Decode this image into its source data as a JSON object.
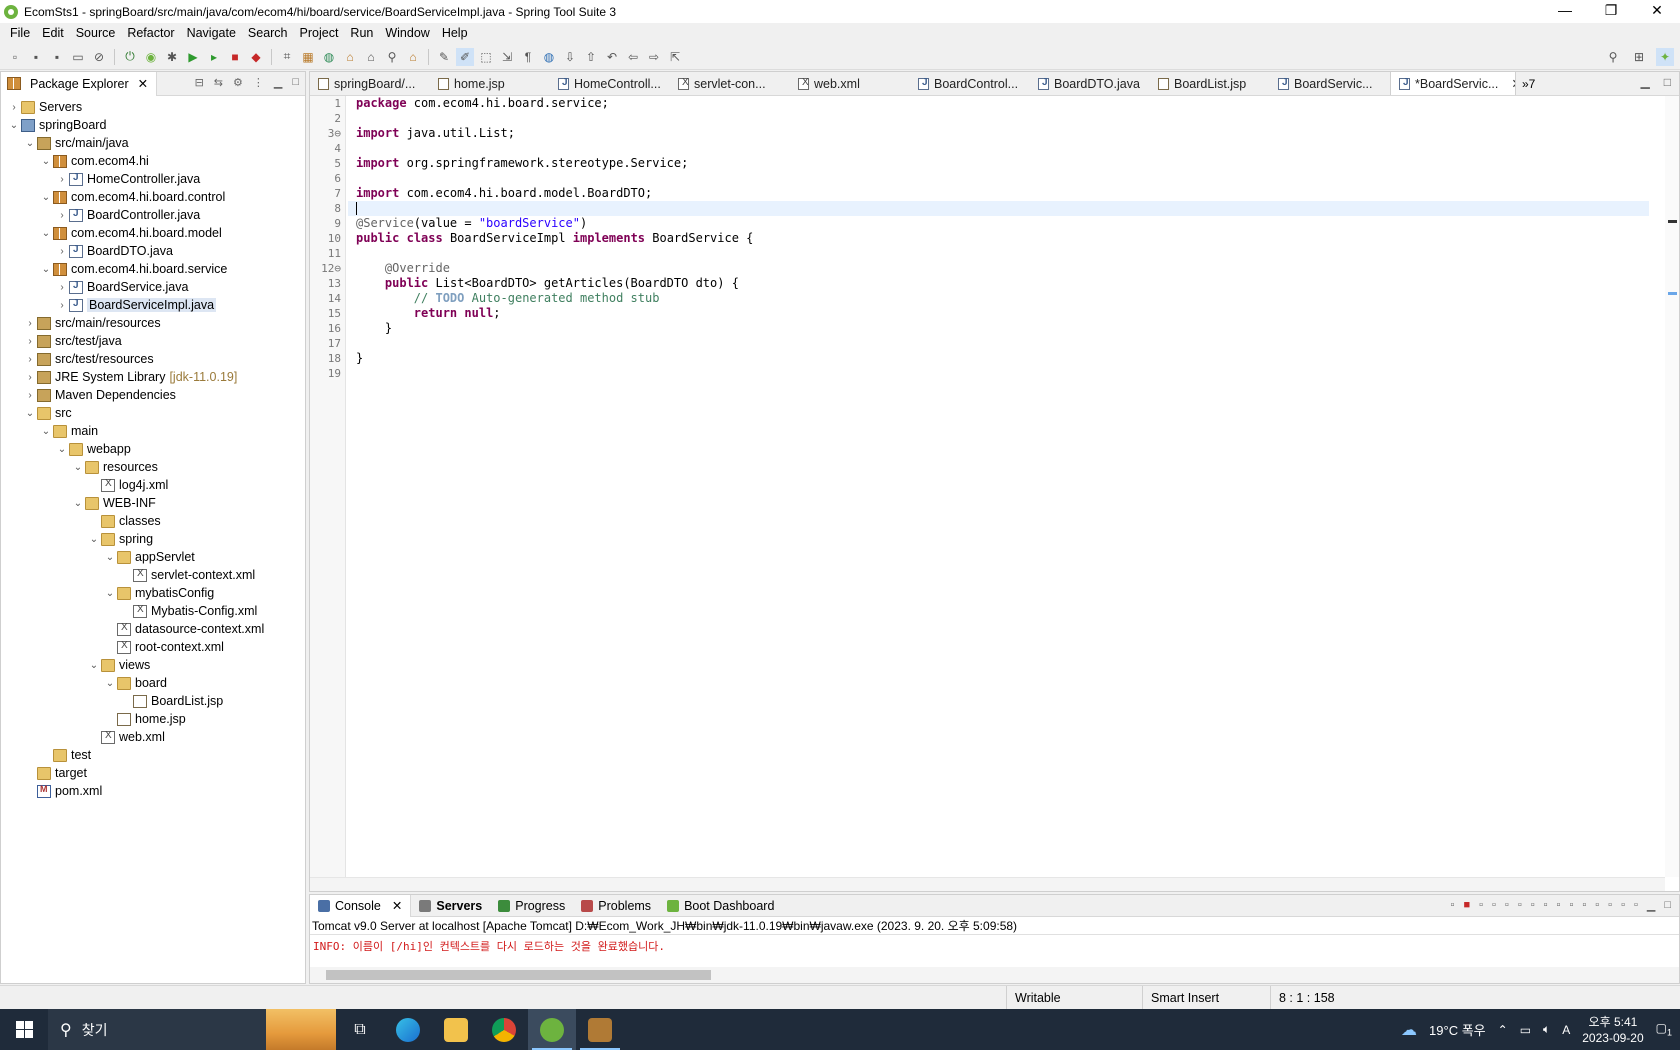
{
  "window": {
    "title": "EcomSts1 - springBoard/src/main/java/com/ecom4/hi/board/service/BoardServiceImpl.java - Spring Tool Suite 3",
    "minimize": "—",
    "restore": "❐",
    "close": "✕"
  },
  "menu": [
    "File",
    "Edit",
    "Source",
    "Refactor",
    "Navigate",
    "Search",
    "Project",
    "Run",
    "Window",
    "Help"
  ],
  "package_explorer": {
    "tab_label": "Package Explorer",
    "tree": [
      {
        "label": "Servers",
        "indent": 0,
        "twisty": "›",
        "icon": "folder"
      },
      {
        "label": "springBoard",
        "indent": 0,
        "twisty": "⌄",
        "icon": "proj"
      },
      {
        "label": "src/main/java",
        "indent": 1,
        "twisty": "⌄",
        "icon": "lib"
      },
      {
        "label": "com.ecom4.hi",
        "indent": 2,
        "twisty": "⌄",
        "icon": "pkg"
      },
      {
        "label": "HomeController.java",
        "indent": 3,
        "twisty": "›",
        "icon": "java"
      },
      {
        "label": "com.ecom4.hi.board.control",
        "indent": 2,
        "twisty": "⌄",
        "icon": "pkg"
      },
      {
        "label": "BoardController.java",
        "indent": 3,
        "twisty": "›",
        "icon": "java"
      },
      {
        "label": "com.ecom4.hi.board.model",
        "indent": 2,
        "twisty": "⌄",
        "icon": "pkg"
      },
      {
        "label": "BoardDTO.java",
        "indent": 3,
        "twisty": "›",
        "icon": "java"
      },
      {
        "label": "com.ecom4.hi.board.service",
        "indent": 2,
        "twisty": "⌄",
        "icon": "pkg"
      },
      {
        "label": "BoardService.java",
        "indent": 3,
        "twisty": "›",
        "icon": "java"
      },
      {
        "label": "BoardServiceImpl.java",
        "indent": 3,
        "twisty": "›",
        "icon": "java",
        "selected": true
      },
      {
        "label": "src/main/resources",
        "indent": 1,
        "twisty": "›",
        "icon": "lib"
      },
      {
        "label": "src/test/java",
        "indent": 1,
        "twisty": "›",
        "icon": "lib"
      },
      {
        "label": "src/test/resources",
        "indent": 1,
        "twisty": "›",
        "icon": "lib"
      },
      {
        "label": "JRE System Library",
        "indent": 1,
        "twisty": "›",
        "icon": "lib",
        "suffix": "[jdk-11.0.19]"
      },
      {
        "label": "Maven Dependencies",
        "indent": 1,
        "twisty": "›",
        "icon": "lib"
      },
      {
        "label": "src",
        "indent": 1,
        "twisty": "⌄",
        "icon": "folder"
      },
      {
        "label": "main",
        "indent": 2,
        "twisty": "⌄",
        "icon": "folder"
      },
      {
        "label": "webapp",
        "indent": 3,
        "twisty": "⌄",
        "icon": "folder"
      },
      {
        "label": "resources",
        "indent": 4,
        "twisty": "⌄",
        "icon": "folder"
      },
      {
        "label": "log4j.xml",
        "indent": 5,
        "twisty": "",
        "icon": "xml"
      },
      {
        "label": "WEB-INF",
        "indent": 4,
        "twisty": "⌄",
        "icon": "folder"
      },
      {
        "label": "classes",
        "indent": 5,
        "twisty": "",
        "icon": "folder"
      },
      {
        "label": "spring",
        "indent": 5,
        "twisty": "⌄",
        "icon": "folder"
      },
      {
        "label": "appServlet",
        "indent": 6,
        "twisty": "⌄",
        "icon": "folder"
      },
      {
        "label": "servlet-context.xml",
        "indent": 7,
        "twisty": "",
        "icon": "xml"
      },
      {
        "label": "mybatisConfig",
        "indent": 6,
        "twisty": "⌄",
        "icon": "folder"
      },
      {
        "label": "Mybatis-Config.xml",
        "indent": 7,
        "twisty": "",
        "icon": "xml"
      },
      {
        "label": "datasource-context.xml",
        "indent": 6,
        "twisty": "",
        "icon": "xml"
      },
      {
        "label": "root-context.xml",
        "indent": 6,
        "twisty": "",
        "icon": "xml"
      },
      {
        "label": "views",
        "indent": 5,
        "twisty": "⌄",
        "icon": "folder"
      },
      {
        "label": "board",
        "indent": 6,
        "twisty": "⌄",
        "icon": "folder"
      },
      {
        "label": "BoardList.jsp",
        "indent": 7,
        "twisty": "",
        "icon": "jsp"
      },
      {
        "label": "home.jsp",
        "indent": 6,
        "twisty": "",
        "icon": "jsp"
      },
      {
        "label": "web.xml",
        "indent": 5,
        "twisty": "",
        "icon": "xml"
      },
      {
        "label": "test",
        "indent": 2,
        "twisty": "",
        "icon": "folder"
      },
      {
        "label": "target",
        "indent": 1,
        "twisty": "",
        "icon": "folder"
      },
      {
        "label": "pom.xml",
        "indent": 1,
        "twisty": "",
        "icon": "mvn"
      }
    ]
  },
  "editor": {
    "tabs": [
      {
        "label": "springBoard/...",
        "icon": "jsp"
      },
      {
        "label": "home.jsp",
        "icon": "jsp"
      },
      {
        "label": "HomeControll...",
        "icon": "java"
      },
      {
        "label": "servlet-con...",
        "icon": "xml"
      },
      {
        "label": "web.xml",
        "icon": "xml"
      },
      {
        "label": "BoardControl...",
        "icon": "java"
      },
      {
        "label": "BoardDTO.java",
        "icon": "java"
      },
      {
        "label": "BoardList.jsp",
        "icon": "jsp"
      },
      {
        "label": "BoardServic...",
        "icon": "java"
      },
      {
        "label": "*BoardServic...",
        "icon": "java",
        "active": true
      }
    ],
    "overflow_label": "»7",
    "lines": [
      {
        "n": "1",
        "tokens": [
          [
            "kw",
            "package"
          ],
          [
            "",
            " com.ecom4.hi.board.service;"
          ]
        ]
      },
      {
        "n": "2",
        "tokens": []
      },
      {
        "n": "3⊖",
        "tokens": [
          [
            "kw",
            "import"
          ],
          [
            "",
            " java.util.List;"
          ]
        ]
      },
      {
        "n": "4",
        "tokens": []
      },
      {
        "n": "5",
        "tokens": [
          [
            "kw",
            "import"
          ],
          [
            "",
            " org.springframework.stereotype.Service;"
          ]
        ]
      },
      {
        "n": "6",
        "tokens": []
      },
      {
        "n": "7",
        "tokens": [
          [
            "kw",
            "import"
          ],
          [
            "",
            " com.ecom4.hi.board.model.BoardDTO;"
          ]
        ]
      },
      {
        "n": "8",
        "tokens": [],
        "current": true
      },
      {
        "n": "9",
        "tokens": [
          [
            "ann",
            "@Service"
          ],
          [
            "",
            "(value = "
          ],
          [
            "str",
            "\"boardService\""
          ],
          [
            "",
            ")"
          ]
        ]
      },
      {
        "n": "10",
        "tokens": [
          [
            "kw",
            "public"
          ],
          [
            "",
            " "
          ],
          [
            "kw",
            "class"
          ],
          [
            "",
            " BoardServiceImpl "
          ],
          [
            "kw",
            "implements"
          ],
          [
            "",
            " BoardService {"
          ]
        ]
      },
      {
        "n": "11",
        "tokens": []
      },
      {
        "n": "12⊖",
        "tokens": [
          [
            "",
            "    "
          ],
          [
            "ann",
            "@Override"
          ]
        ]
      },
      {
        "n": "13",
        "tokens": [
          [
            "",
            "    "
          ],
          [
            "kw",
            "public"
          ],
          [
            "",
            " List<BoardDTO> getArticles(BoardDTO dto) {"
          ]
        ]
      },
      {
        "n": "14",
        "tokens": [
          [
            "",
            "        "
          ],
          [
            "cmt",
            "// "
          ],
          [
            "todo",
            "TODO"
          ],
          [
            "cmt",
            " Auto-generated method stub"
          ]
        ]
      },
      {
        "n": "15",
        "tokens": [
          [
            "",
            "        "
          ],
          [
            "kw",
            "return"
          ],
          [
            "",
            " "
          ],
          [
            "kw",
            "null"
          ],
          [
            "",
            ";"
          ]
        ]
      },
      {
        "n": "16",
        "tokens": [
          [
            "",
            "    }"
          ]
        ]
      },
      {
        "n": "17",
        "tokens": []
      },
      {
        "n": "18",
        "tokens": [
          [
            "",
            "}"
          ]
        ]
      },
      {
        "n": "19",
        "tokens": []
      }
    ]
  },
  "console": {
    "tabs": [
      {
        "label": "Console",
        "active": true,
        "color": "#4a6fa5"
      },
      {
        "label": "Servers",
        "bold": true,
        "color": "#7a7a7a"
      },
      {
        "label": "Progress",
        "color": "#3c8c3c"
      },
      {
        "label": "Problems",
        "color": "#b84a4a"
      },
      {
        "label": "Boot Dashboard",
        "color": "#6db33f"
      }
    ],
    "server_line": "Tomcat v9.0 Server at localhost [Apache Tomcat] D:₩Ecom_Work_JH₩bin₩jdk-11.0.19₩bin₩javaw.exe  (2023. 9. 20. 오후 5:09:58)",
    "output": "INFO: 이름이 [/hi]인 컨텍스트를 다시 로드하는 것을 완료했습니다."
  },
  "status": {
    "writable": "Writable",
    "insert_mode": "Smart Insert",
    "position": "8 : 1 : 158"
  },
  "taskbar": {
    "search_placeholder": "찾기",
    "weather": "19°C  폭우",
    "time": "오후 5:41",
    "date": "2023-09-20",
    "notification_count": "1"
  }
}
